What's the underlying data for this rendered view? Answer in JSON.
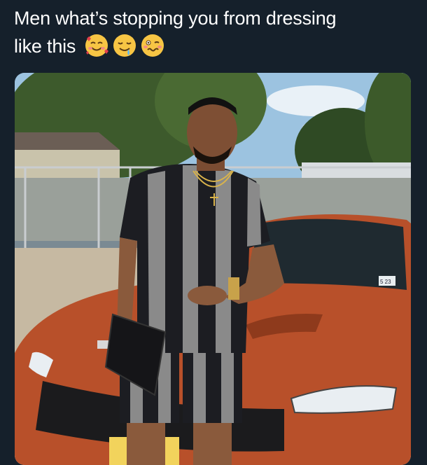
{
  "tweet": {
    "text_line1": "Men what’s stopping you from dressing",
    "text_line2": "like this",
    "emojis": [
      "smiling-face-with-hearts-icon",
      "drooling-face-icon",
      "woozy-face-icon"
    ]
  },
  "media": {
    "license_plate_text": "sey",
    "window_sticker_text": "5 23"
  },
  "colors": {
    "background": "#15202b",
    "text": "#ffffff",
    "car": "#b8502a",
    "shirt_stripe_dark": "#1c1d22",
    "shirt_stripe_light": "#8a8a8a"
  }
}
